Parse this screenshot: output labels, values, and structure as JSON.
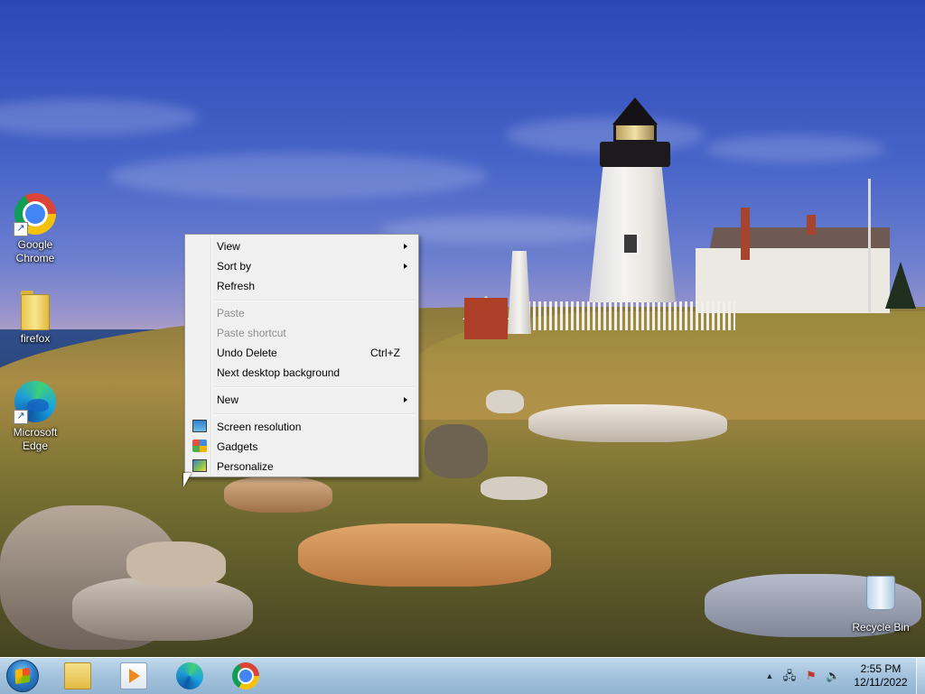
{
  "desktop": {
    "icons": [
      {
        "label": "Google\nChrome",
        "label_line1": "Google",
        "label_line2": "Chrome",
        "icon": "chrome-icon"
      },
      {
        "label_line1": "firefox",
        "icon": "folder-icon"
      },
      {
        "label_line1": "Microsoft",
        "label_line2": "Edge",
        "icon": "edge-icon"
      },
      {
        "label_line1": "Recycle Bin",
        "icon": "recycle-bin-icon"
      }
    ]
  },
  "context_menu": {
    "items": [
      {
        "label": "View",
        "submenu": true,
        "enabled": true
      },
      {
        "label": "Sort by",
        "submenu": true,
        "enabled": true
      },
      {
        "label": "Refresh",
        "enabled": true
      },
      {
        "label": "Paste",
        "enabled": false
      },
      {
        "label": "Paste shortcut",
        "enabled": false
      },
      {
        "label": "Undo Delete",
        "shortcut": "Ctrl+Z",
        "enabled": true
      },
      {
        "label": "Next desktop background",
        "enabled": true
      },
      {
        "label": "New",
        "submenu": true,
        "enabled": true
      },
      {
        "label": "Screen resolution",
        "icon": "monitor-icon",
        "enabled": true
      },
      {
        "label": "Gadgets",
        "icon": "gadgets-icon",
        "enabled": true
      },
      {
        "label": "Personalize",
        "icon": "personalize-icon",
        "enabled": true
      }
    ]
  },
  "taskbar": {
    "pinned": [
      {
        "name": "Windows Explorer",
        "icon": "folder-icon"
      },
      {
        "name": "Windows Media Player",
        "icon": "media-player-icon"
      },
      {
        "name": "Microsoft Edge",
        "icon": "edge-icon"
      },
      {
        "name": "Google Chrome",
        "icon": "chrome-icon"
      }
    ],
    "tray": {
      "show_hidden": "▲",
      "network": "network-icon",
      "action_center": "flag-icon",
      "volume": "speaker-icon"
    },
    "clock": {
      "time": "2:55 PM",
      "date": "12/11/2022"
    }
  },
  "colors": {
    "menu_bg": "#f0f0f0",
    "menu_disabled_text": "#8d8d8d",
    "taskbar": "#9dbeda"
  }
}
